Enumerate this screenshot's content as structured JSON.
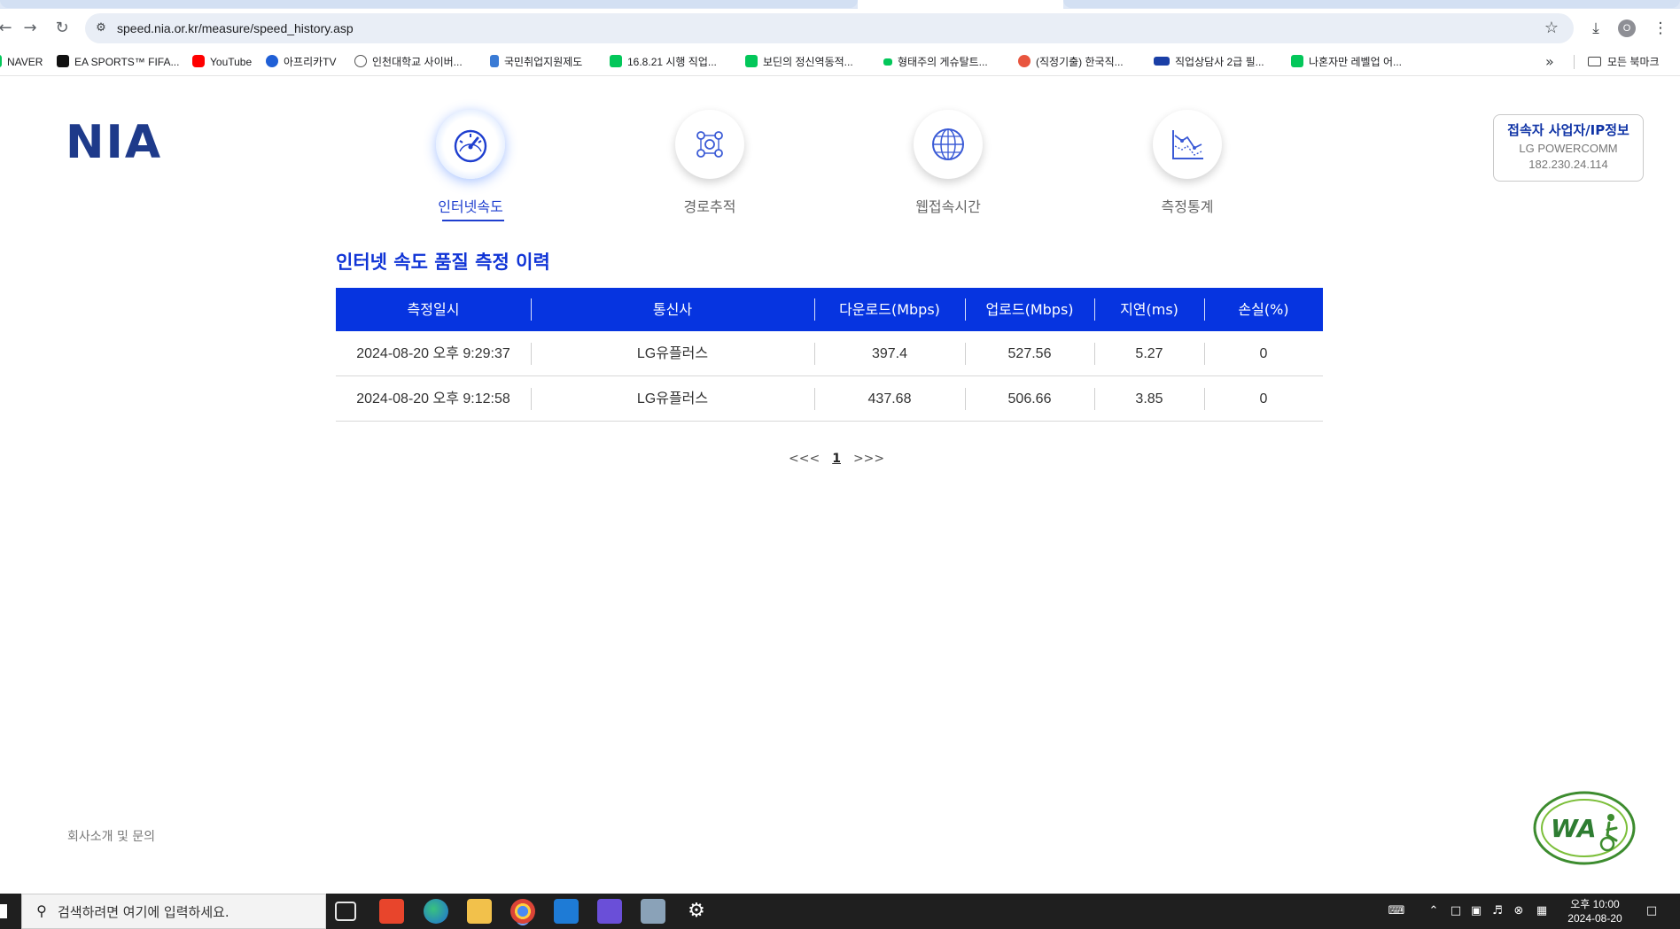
{
  "browser": {
    "url": "speed.nia.or.kr/measure/speed_history.asp",
    "bookmarks": [
      {
        "label": "NAVER",
        "color": "#03c75a"
      },
      {
        "label": "EA SPORTS™ FIFA...",
        "color": "#111111"
      },
      {
        "label": "YouTube",
        "color": "#ff0000"
      },
      {
        "label": "아프리카TV",
        "color": "#1f5fd6"
      },
      {
        "label": "인천대학교 사이버...",
        "color": "#555555"
      },
      {
        "label": "국민취업지원제도",
        "color": "#3a7bd5"
      },
      {
        "label": "16.8.21 시행 직업...",
        "color": "#03c75a"
      },
      {
        "label": "보딘의 정신역동적...",
        "color": "#03c75a"
      },
      {
        "label": "형태주의 게슈탈트...",
        "color": "#03c75a"
      },
      {
        "label": "(직정기출) 한국직...",
        "color": "#e8553e"
      },
      {
        "label": "직업상담사 2급 필...",
        "color": "#1a3fa6"
      },
      {
        "label": "나혼자만 레벨업 어...",
        "color": "#03c75a"
      }
    ],
    "all_bookmarks_label": "모든 북마크",
    "profile_initial": "O"
  },
  "site": {
    "logo": "NIA",
    "nav": [
      {
        "label": "인터넷속도",
        "icon": "speedometer-icon",
        "active": true
      },
      {
        "label": "경로추적",
        "icon": "route-icon",
        "active": false
      },
      {
        "label": "웹접속시간",
        "icon": "globe-icon",
        "active": false
      },
      {
        "label": "측정통계",
        "icon": "statistics-icon",
        "active": false
      }
    ],
    "isp": {
      "title": "접속자 사업자/IP정보",
      "provider": "LG POWERCOMM",
      "ip": "182.230.24.114"
    },
    "page_title": "인터넷 속도 품질 측정 이력",
    "table": {
      "headers": [
        "측정일시",
        "통신사",
        "다운로드(Mbps)",
        "업로드(Mbps)",
        "지연(ms)",
        "손실(%)"
      ],
      "rows": [
        [
          "2024-08-20 오후 9:29:37",
          "LG유플러스",
          "397.4",
          "527.56",
          "5.27",
          "0"
        ],
        [
          "2024-08-20 오후 9:12:58",
          "LG유플러스",
          "437.68",
          "506.66",
          "3.85",
          "0"
        ]
      ]
    },
    "pager": {
      "prev": "<<<",
      "current": "1",
      "next": ">>>"
    },
    "footer_link": "회사소개 및 문의",
    "accent_color": "#0634e0"
  },
  "taskbar": {
    "search_placeholder": "검색하려면 여기에 입력하세요.",
    "time": "오후 10:00",
    "date": "2024-08-20"
  }
}
